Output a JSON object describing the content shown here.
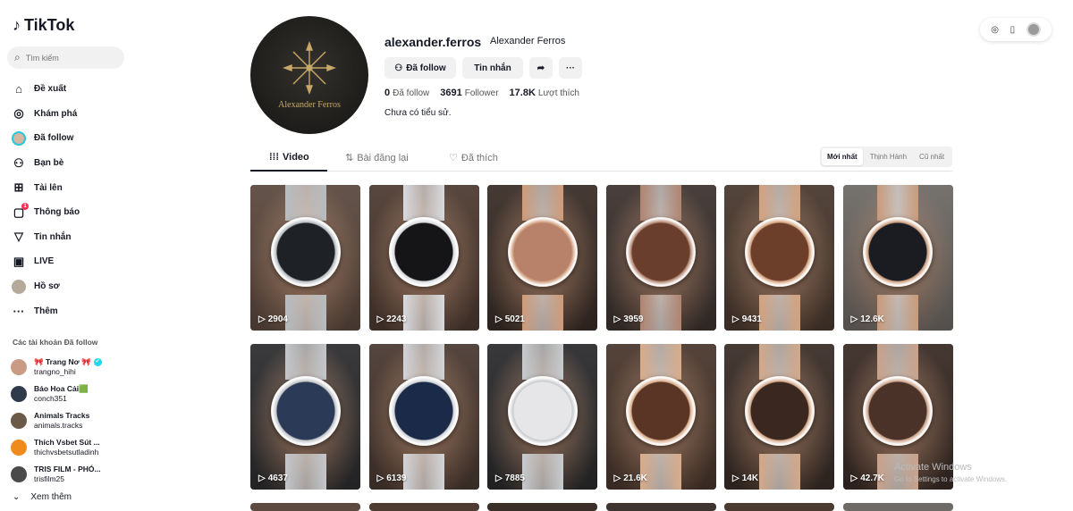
{
  "app": {
    "logo_text": "TikTok"
  },
  "search": {
    "placeholder": "Tìm kiếm"
  },
  "nav": [
    {
      "label": "Đề xuất",
      "icon": "home-icon",
      "glyph": "⌂"
    },
    {
      "label": "Khám phá",
      "icon": "compass-icon",
      "glyph": "◎"
    },
    {
      "label": "Đã follow",
      "icon": "following-avatar",
      "glyph": ""
    },
    {
      "label": "Bạn bè",
      "icon": "friends-icon",
      "glyph": "⚇"
    },
    {
      "label": "Tải lên",
      "icon": "upload-icon",
      "glyph": "⊞"
    },
    {
      "label": "Thông báo",
      "icon": "notification-icon",
      "glyph": "▢",
      "badge": "1"
    },
    {
      "label": "Tin nhắn",
      "icon": "message-icon",
      "glyph": "▽"
    },
    {
      "label": "LIVE",
      "icon": "live-icon",
      "glyph": "▣"
    },
    {
      "label": "Hồ sơ",
      "icon": "profile-avatar",
      "glyph": ""
    },
    {
      "label": "Thêm",
      "icon": "more-icon",
      "glyph": "···"
    }
  ],
  "following": {
    "title": "Các tài khoản Đã follow",
    "accounts": [
      {
        "name": "🎀 Trang Nơ 🎀",
        "handle": "trangno_hihi",
        "verified": true,
        "color": "#c99a84"
      },
      {
        "name": "Báo Hoa Cải🟩",
        "handle": "conch351",
        "verified": false,
        "color": "#2f3a4a"
      },
      {
        "name": "Animals Tracks",
        "handle": "animals.tracks",
        "verified": false,
        "color": "#6b5a48"
      },
      {
        "name": "Thích Vsbet Sút ...",
        "handle": "thichvsbetsutladinh",
        "verified": false,
        "color": "#f08a1c"
      },
      {
        "name": "TRIS FILM - PHÓ...",
        "handle": "trisfilm25",
        "verified": false,
        "color": "#4a4a4a"
      }
    ],
    "see_more": "Xem thêm"
  },
  "profile": {
    "username": "alexander.ferros",
    "display_name": "Alexander Ferros",
    "avatar_brand": "Alexander Ferros",
    "follow_button": "Đã follow",
    "message_button": "Tin nhắn",
    "stats": [
      {
        "value": "0",
        "label": "Đã follow"
      },
      {
        "value": "3691",
        "label": "Follower"
      },
      {
        "value": "17.8K",
        "label": "Lượt thích"
      }
    ],
    "bio": "Chưa có tiểu sử."
  },
  "tabs": [
    {
      "label": "Video",
      "icon": "grid-icon",
      "glyph": "⁞⁞⁞"
    },
    {
      "label": "Bài đăng lại",
      "icon": "repost-icon",
      "glyph": "⇅"
    },
    {
      "label": "Đã thích",
      "icon": "heart-icon",
      "glyph": "♡"
    }
  ],
  "sort": [
    "Mới nhất",
    "Thịnh Hành",
    "Cũ nhất"
  ],
  "videos": [
    {
      "views": "2904",
      "bg": "#5c4a40",
      "dial": "#1e2226",
      "case": "#b8bcc0"
    },
    {
      "views": "2243",
      "bg": "#4e3c33",
      "dial": "#151517",
      "case": "#d8dade"
    },
    {
      "views": "5021",
      "bg": "#3a2e28",
      "dial": "#b8826a",
      "case": "#cf9b7a"
    },
    {
      "views": "3959",
      "bg": "#3e3430",
      "dial": "#6a3e2c",
      "case": "#b08470"
    },
    {
      "views": "9431",
      "bg": "#4a3a30",
      "dial": "#6b3f2a",
      "case": "#d4a27e"
    },
    {
      "views": "12.6K",
      "bg": "#6e6a66",
      "dial": "#1a1c22",
      "case": "#c99a7a"
    },
    {
      "views": "4637",
      "bg": "#2e2e30",
      "dial": "#2b3a56",
      "case": "#c4c6ca"
    },
    {
      "views": "6139",
      "bg": "#4a3a32",
      "dial": "#1c2a4a",
      "case": "#d2d4d8"
    },
    {
      "views": "7885",
      "bg": "#2c2c2e",
      "dial": "#e6e6e8",
      "case": "#c8cacd"
    },
    {
      "views": "21.6K",
      "bg": "#4a382e",
      "dial": "#5a3424",
      "case": "#d8ac8a"
    },
    {
      "views": "14K",
      "bg": "#3a2e28",
      "dial": "#3a2820",
      "case": "#d4a888"
    },
    {
      "views": "42.7K",
      "bg": "#3a2c26",
      "dial": "#4a3228",
      "case": "#caa28a"
    }
  ],
  "watermark": {
    "title": "Activate Windows",
    "subtitle": "Go to Settings to activate Windows."
  }
}
